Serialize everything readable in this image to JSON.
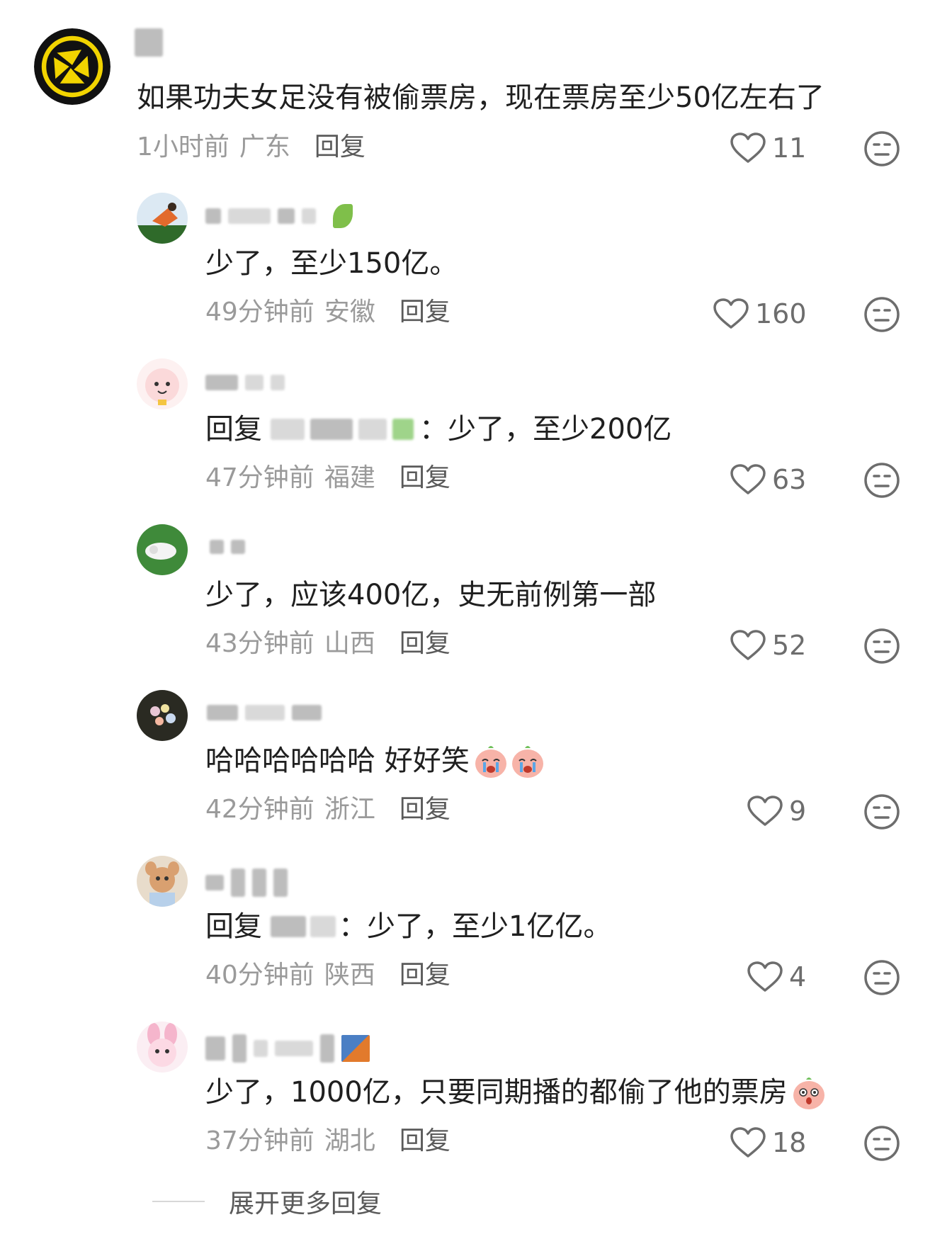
{
  "comments": [
    {
      "body": "如果功夫女足没有被偷票房，现在票房至少50亿左右了",
      "time": "1小时前",
      "location": "广东",
      "reply": "回复",
      "likes": "11"
    },
    {
      "body": "少了，至少150亿。",
      "time": "49分钟前",
      "location": "安徽",
      "reply": "回复",
      "likes": "160"
    },
    {
      "reply_prefix": "回复",
      "body": "：少了，至少200亿",
      "time": "47分钟前",
      "location": "福建",
      "reply": "回复",
      "likes": "63"
    },
    {
      "body": "少了，应该400亿，史无前例第一部",
      "time": "43分钟前",
      "location": "山西",
      "reply": "回复",
      "likes": "52"
    },
    {
      "body": "哈哈哈哈哈哈 好好笑",
      "time": "42分钟前",
      "location": "浙江",
      "reply": "回复",
      "likes": "9"
    },
    {
      "reply_prefix": "回复",
      "body": "：少了，至少1亿亿。",
      "time": "40分钟前",
      "location": "陕西",
      "reply": "回复",
      "likes": "4"
    },
    {
      "body": "少了，1000亿，只要同期播的都偷了他的票房",
      "time": "37分钟前",
      "location": "湖北",
      "reply": "回复",
      "likes": "18"
    }
  ],
  "expand_label": "展开更多回复",
  "icons": {
    "like": "heart-outline-icon",
    "dislike": "neutral-face-icon",
    "emoji_cry": "crying-peach-emoji",
    "emoji_shock": "shocked-peach-emoji"
  },
  "colors": {
    "text": "#1f1f1f",
    "meta": "#9a9a9a",
    "reply": "#5a5a5a",
    "icon": "#6d6d6d",
    "logo_yellow": "#f2d400"
  }
}
